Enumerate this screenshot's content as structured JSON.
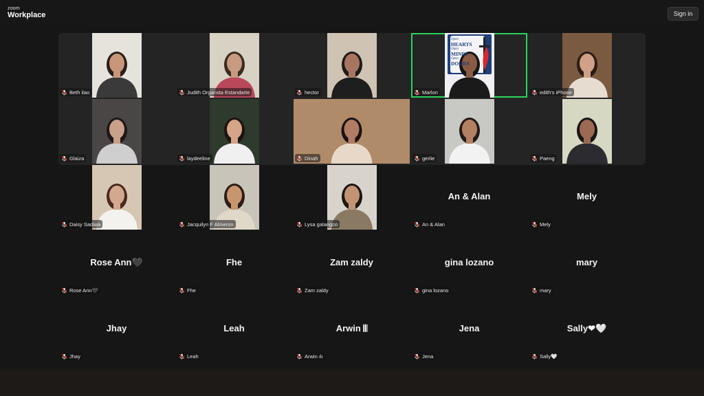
{
  "app": {
    "logo_small": "zoom",
    "logo_big": "Workplace",
    "signin_label": "Sign in"
  },
  "participants": [
    {
      "tag": "Beth ilao",
      "video": "narrow",
      "bg": "#e6e3dc",
      "skin": "#c9967a",
      "hair": "#2a1e18",
      "shirt": "#3a3a3a"
    },
    {
      "tag": "Judith Organsta Estandarte",
      "video": "narrow",
      "bg": "#d8d2c4",
      "skin": "#c89a80",
      "hair": "#3b2a20",
      "shirt": "#b8485a"
    },
    {
      "tag": "hector",
      "video": "narrow",
      "bg": "#cfc3b4",
      "skin": "#a87660",
      "hair": "#1e1a18",
      "shirt": "#1e1e1e"
    },
    {
      "tag": "Marlon",
      "video": "narrow",
      "bg": "#f0f0f4",
      "skin": "#8a5a44",
      "hair": "#151515",
      "shirt": "#1a1a1a",
      "active": true,
      "sign_lines": [
        "Open",
        "HEARTS",
        "Open",
        "MINDS",
        "Open",
        "DOORS"
      ]
    },
    {
      "tag": "edith's iPhone",
      "video": "narrow",
      "bg": "#7a5a40",
      "skin": "#d0a088",
      "hair": "#2b1c15",
      "shirt": "#e6ddd0"
    },
    {
      "tag": "Glaiza",
      "video": "narrow",
      "bg": "#4a4646",
      "skin": "#c9a08a",
      "hair": "#1f1815",
      "shirt": "#cfcfcf"
    },
    {
      "tag": "laydeeline",
      "video": "narrow",
      "bg": "#2e3a2c",
      "skin": "#d6a488",
      "hair": "#1c1410",
      "shirt": "#f0f0f0"
    },
    {
      "tag": "Dinah",
      "video": "wide",
      "bg": "#b08b6a",
      "skin": "#b07c64",
      "hair": "#1a1210",
      "shirt": "#e8d8c8"
    },
    {
      "tag": "gerlie",
      "video": "narrow",
      "bg": "#c8c8c4",
      "skin": "#b48064",
      "hair": "#241a15",
      "shirt": "#f2f2f2"
    },
    {
      "tag": "Paeng",
      "video": "narrow",
      "bg": "#d6d8c4",
      "skin": "#9a6a52",
      "hair": "#1a1614",
      "shirt": "#2c2c30"
    },
    {
      "tag": "Daisy Sadiwa",
      "video": "narrow",
      "bg": "#d6c6b4",
      "skin": "#d2a88e",
      "hair": "#4a2a1c",
      "shirt": "#f4f2ee"
    },
    {
      "tag": "Jacquilyn F Almeron",
      "video": "narrow",
      "bg": "#c8c4ba",
      "skin": "#c8966e",
      "hair": "#2a1d16",
      "shirt": "#e0d8c8"
    },
    {
      "tag": "Lysa galangco",
      "video": "narrow",
      "bg": "#d8d4cc",
      "skin": "#c29476",
      "hair": "#1f1712",
      "shirt": "#8a7a64"
    },
    {
      "tag": "An & Alan",
      "big": "An & Alan"
    },
    {
      "tag": "Mely",
      "big": "Mely"
    },
    {
      "tag": "Rose Ann🖤",
      "big": "Rose Ann🖤"
    },
    {
      "tag": "Fhe",
      "big": "Fhe"
    },
    {
      "tag": "Zam zaldy",
      "big": "Zam zaldy"
    },
    {
      "tag": "gina lozano",
      "big": "gina lozano"
    },
    {
      "tag": "mary",
      "big": "mary"
    },
    {
      "tag": "Jhay",
      "big": "Jhay"
    },
    {
      "tag": "Leah",
      "big": "Leah"
    },
    {
      "tag": "Arwin ılı",
      "big": "Arwin 𝄃𝄃"
    },
    {
      "tag": "Jena",
      "big": "Jena"
    },
    {
      "tag": "Sally🤍",
      "big": "Sally❤︎🤍"
    }
  ],
  "colors": {
    "active_border": "#2bd45b",
    "muted_mic": "#e0362c"
  }
}
